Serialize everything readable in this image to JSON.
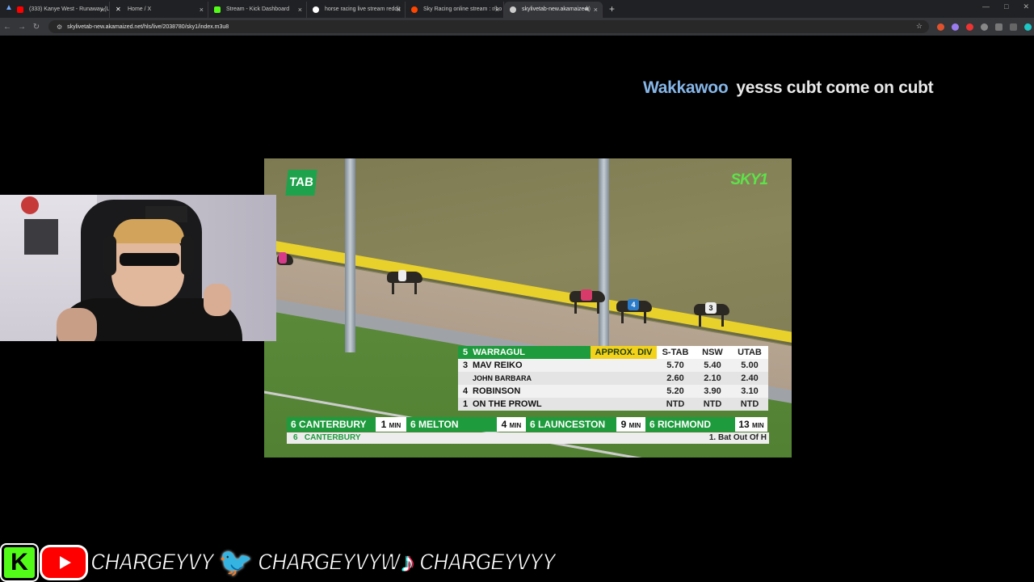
{
  "browser": {
    "tabs": [
      {
        "label": "(333) Kanye West - Runaway (L",
        "favicon_color": "#ff0000"
      },
      {
        "label": "Home / X",
        "favicon_color": "#ffffff"
      },
      {
        "label": "Stream - Kick Dashboard",
        "favicon_color": "#53fc18"
      },
      {
        "label": "horse racing live stream reddit",
        "favicon_color": "#ffffff"
      },
      {
        "label": "Sky Racing online stream : r/ho",
        "favicon_color": "#ff4500"
      },
      {
        "label": "skylivetab-new.akamaized.",
        "favicon_color": "#cccccc"
      }
    ],
    "new_tab": "+",
    "url": "skylivetab-new.akamaized.net/hls/live/2038780/sky1/index.m3u8"
  },
  "chat": {
    "user": "Wakkawoo",
    "message": "yesss cubt come on cubt"
  },
  "broadcast": {
    "tab_logo": "TAB",
    "sky_logo": "SKY1",
    "dog_numbers": [
      "4",
      "3",
      "5"
    ],
    "odds": {
      "race_num": "5",
      "venue": "WARRAGUL",
      "approx_label": "APPROX. DIV",
      "columns": [
        "S-TAB",
        "NSW",
        "UTAB"
      ],
      "rows": [
        {
          "num": "3",
          "name": "MAV REIKO",
          "vals": [
            "5.70",
            "5.40",
            "5.00"
          ],
          "sub": false
        },
        {
          "num": "",
          "name": "JOHN BARBARA",
          "vals": [
            "2.60",
            "2.10",
            "2.40"
          ],
          "sub": true
        },
        {
          "num": "4",
          "name": "ROBINSON",
          "vals": [
            "5.20",
            "3.90",
            "3.10"
          ],
          "sub": false
        },
        {
          "num": "1",
          "name": "ON THE PROWL",
          "vals": [
            "NTD",
            "NTD",
            "NTD"
          ],
          "sub": false
        }
      ]
    },
    "ticker": [
      {
        "venue": "6 CANTERBURY",
        "mins": "1",
        "unit": "MIN"
      },
      {
        "venue": "6 MELTON",
        "mins": "4",
        "unit": "MIN"
      },
      {
        "venue": "6 LAUNCESTON",
        "mins": "9",
        "unit": "MIN"
      },
      {
        "venue": "6 RICHMOND",
        "mins": "13",
        "unit": "MIN"
      }
    ],
    "ticker2": {
      "left": "6   CANTERBURY",
      "right": "1. Bat Out Of H"
    }
  },
  "socials": {
    "kick_letter": "K",
    "kick_handle": "CHARGEYVY",
    "twitter_handle": "CHARGEYVYW",
    "tiktok_handle": "CHARGEYVYY"
  }
}
